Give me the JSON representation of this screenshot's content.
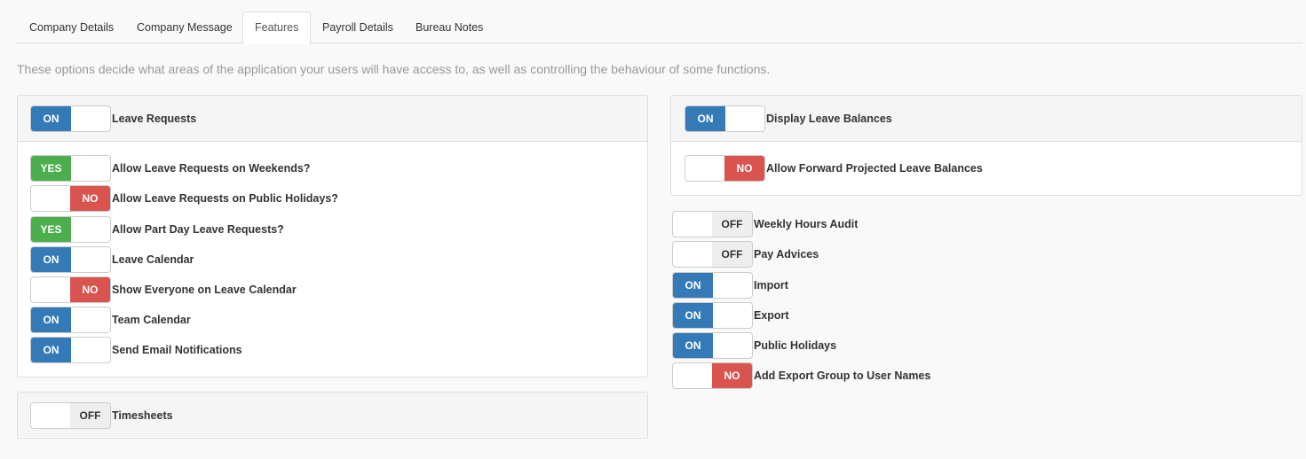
{
  "tabs": [
    {
      "label": "Company Details",
      "active": false
    },
    {
      "label": "Company Message",
      "active": false
    },
    {
      "label": "Features",
      "active": true
    },
    {
      "label": "Payroll Details",
      "active": false
    },
    {
      "label": "Bureau Notes",
      "active": false
    }
  ],
  "intro": "These options decide what areas of the application your users will have access to, as well as controlling the behaviour of some functions.",
  "leave_requests": {
    "header": {
      "state": "ON",
      "label": "Leave Requests"
    },
    "items": [
      {
        "state": "YES",
        "label": "Allow Leave Requests on Weekends?"
      },
      {
        "state": "NO",
        "label": "Allow Leave Requests on Public Holidays?"
      },
      {
        "state": "YES",
        "label": "Allow Part Day Leave Requests?"
      },
      {
        "state": "ON",
        "label": "Leave Calendar"
      },
      {
        "state": "NO",
        "label": "Show Everyone on Leave Calendar"
      },
      {
        "state": "ON",
        "label": "Team Calendar"
      },
      {
        "state": "ON",
        "label": "Send Email Notifications"
      }
    ]
  },
  "timesheets": {
    "state": "OFF",
    "label": "Timesheets"
  },
  "leave_balances": {
    "header": {
      "state": "ON",
      "label": "Display Leave Balances"
    },
    "items": [
      {
        "state": "NO",
        "label": "Allow Forward Projected Leave Balances"
      }
    ]
  },
  "other_features": [
    {
      "state": "OFF",
      "label": "Weekly Hours Audit"
    },
    {
      "state": "OFF",
      "label": "Pay Advices"
    },
    {
      "state": "ON",
      "label": "Import"
    },
    {
      "state": "ON",
      "label": "Export"
    },
    {
      "state": "ON",
      "label": "Public Holidays"
    },
    {
      "state": "NO",
      "label": "Add Export Group to User Names"
    }
  ],
  "colors": {
    "on": "#337ab7",
    "yes": "#4cae4c",
    "no": "#d9534f",
    "off": "#eeeeee"
  }
}
